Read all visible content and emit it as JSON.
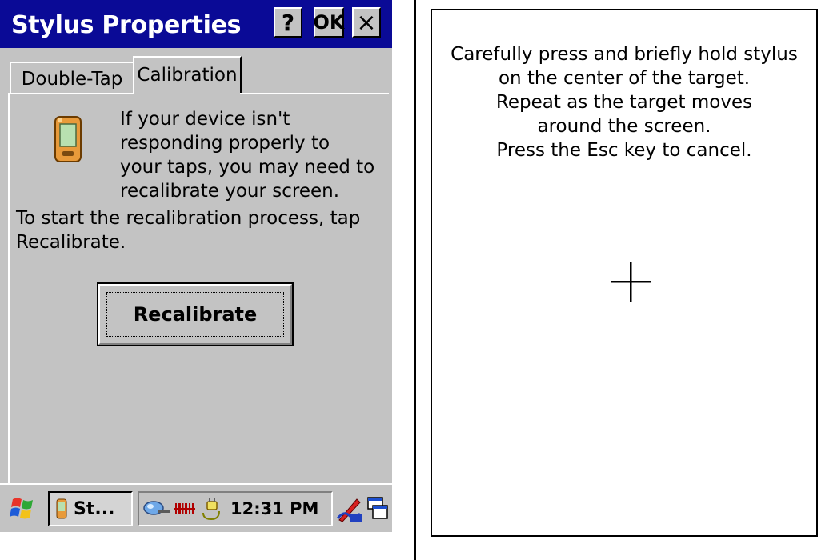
{
  "dialog": {
    "title": "Stylus Properties",
    "help_label": "?",
    "ok_label": "OK",
    "close_label": "×",
    "tabs": [
      {
        "label": "Double-Tap",
        "selected": false
      },
      {
        "label": "Calibration",
        "selected": true
      }
    ],
    "info_text": "If your device isn't responding properly to your taps, you may need to recalibrate your screen.",
    "start_text": "To start the recalibration process, tap Recalibrate.",
    "recalibrate_label": "Recalibrate"
  },
  "taskbar": {
    "start_icon": "windows-flag-icon",
    "task_label": "St...",
    "tray_icons": [
      "network-icon",
      "barcode-scanner-icon",
      "power-plug-icon"
    ],
    "clock": "12:31 PM",
    "input_icon": "input-panel-icon",
    "desktop_icon": "show-desktop-icon"
  },
  "calibration_screen": {
    "lines": [
      "Carefully press and briefly hold stylus",
      "on the center of the target.",
      "Repeat as the target moves",
      "around the screen.",
      "Press the Esc key to cancel."
    ],
    "target_icon": "crosshair-target-icon"
  },
  "colors": {
    "titlebar": "#0a0a96",
    "face": "#c3c3c3"
  }
}
